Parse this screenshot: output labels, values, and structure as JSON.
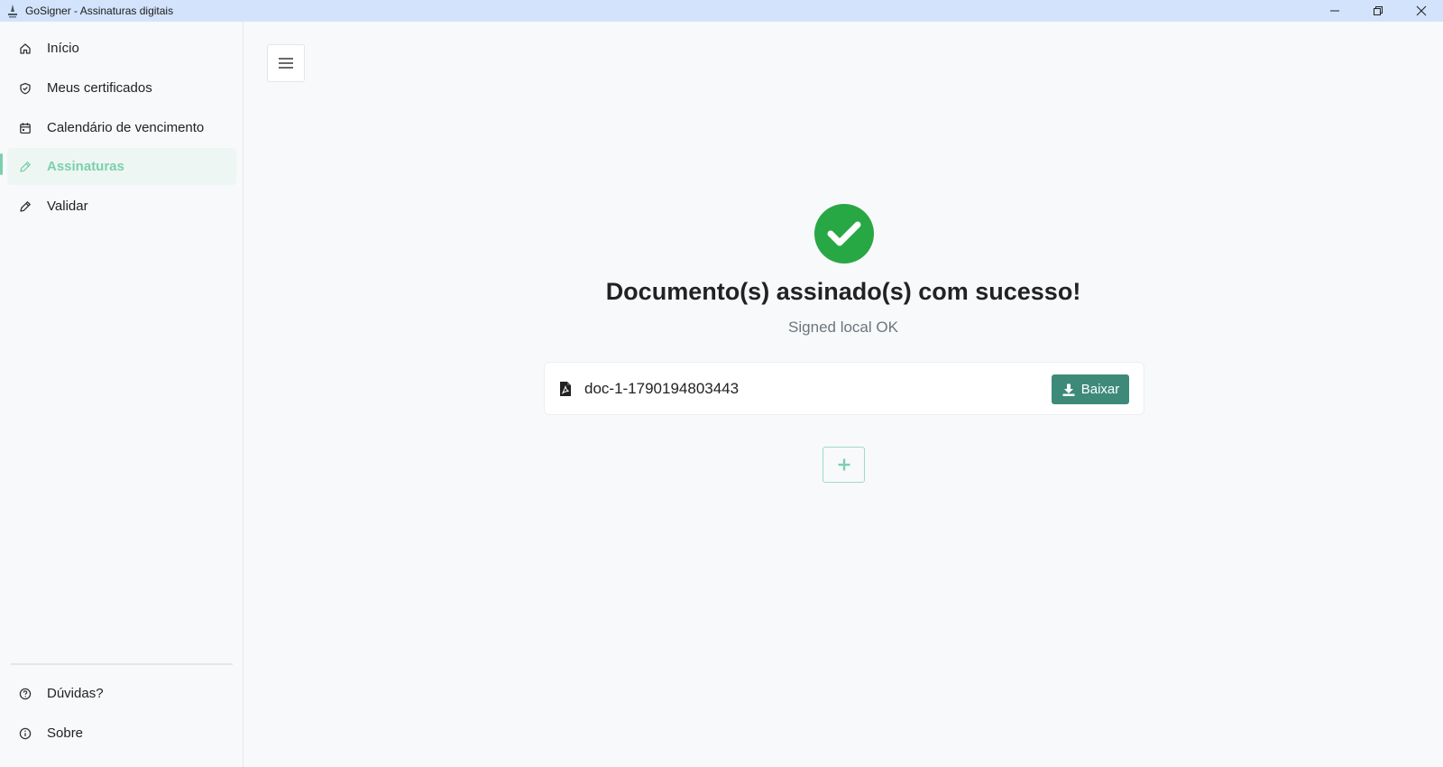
{
  "window": {
    "title": "GoSigner - Assinaturas digitais",
    "logo_icon": "gosigner-logo-icon",
    "controls": [
      "minimize-icon",
      "restore-icon",
      "close-icon"
    ]
  },
  "sidebar": {
    "items": [
      {
        "label": "Início",
        "icon": "home-icon"
      },
      {
        "label": "Meus certificados",
        "icon": "shield-check-icon"
      },
      {
        "label": "Calendário de vencimento",
        "icon": "calendar-icon"
      },
      {
        "label": "Assinaturas",
        "icon": "pen-icon",
        "active": true
      },
      {
        "label": "Validar",
        "icon": "pen-icon"
      }
    ],
    "footer_items": [
      {
        "label": "Dúvidas?",
        "icon": "help-circle-icon"
      },
      {
        "label": "Sobre",
        "icon": "info-circle-icon"
      }
    ]
  },
  "main": {
    "menu_icon": "hamburger-icon",
    "success_icon": "check-circle-icon",
    "title": "Documento(s) assinado(s) com sucesso!",
    "subtitle": "Signed local OK",
    "documents": [
      {
        "name": "doc-1-1790194803443",
        "icon": "pdf-file-icon",
        "download_label": "Baixar"
      }
    ],
    "add_icon": "plus-icon"
  },
  "colors": {
    "accent": "#7ad0ad",
    "success": "#28a745",
    "download_button": "#3e8a78",
    "titlebar": "#d3e3fb"
  }
}
